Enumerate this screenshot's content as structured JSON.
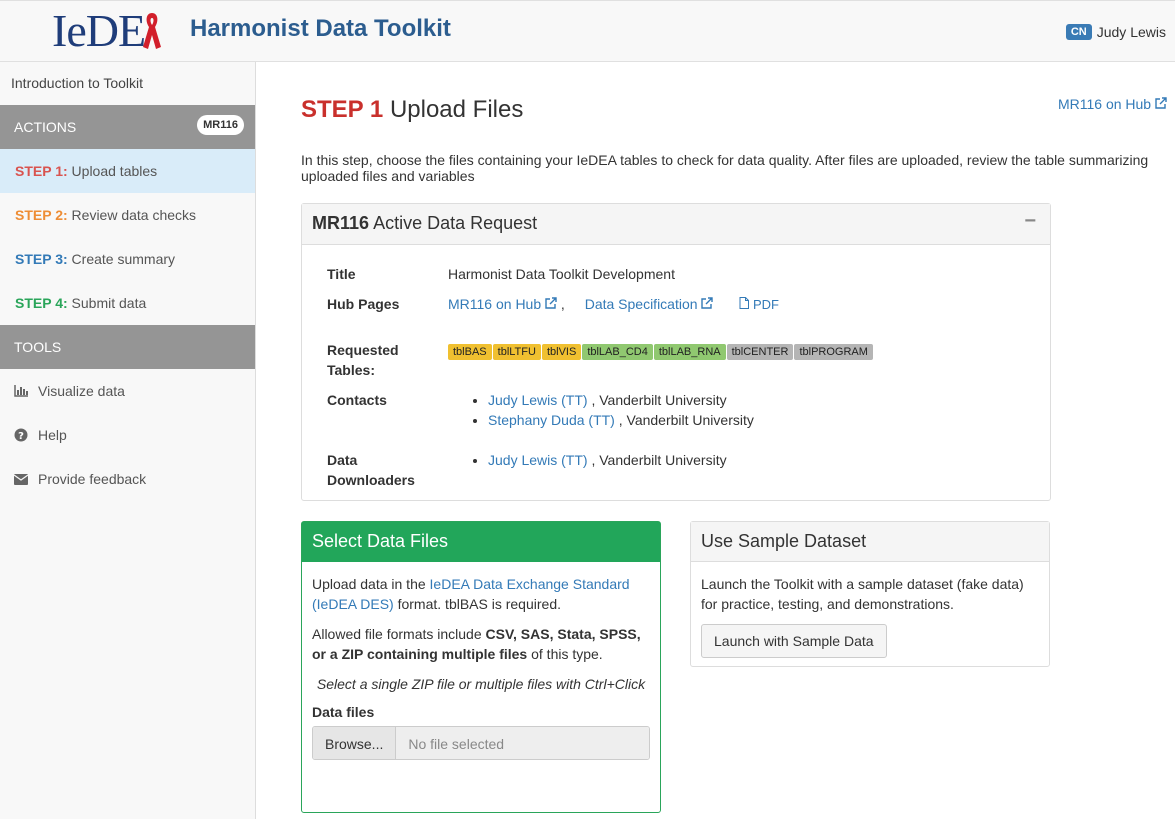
{
  "header": {
    "logo": "IeDE",
    "title": "Harmonist Data Toolkit",
    "user_initials": "CN",
    "user_name": "Judy Lewis"
  },
  "sidebar": {
    "intro": "Introduction to Toolkit",
    "actions_label": "ACTIONS",
    "actions_badge": "MR116",
    "steps": [
      {
        "step": "STEP 1:",
        "label": "Upload tables",
        "color": "#d9534f"
      },
      {
        "step": "STEP 2:",
        "label": "Review data checks",
        "color": "#ee8d35"
      },
      {
        "step": "STEP 3:",
        "label": "Create summary",
        "color": "#337ab7"
      },
      {
        "step": "STEP 4:",
        "label": "Submit data",
        "color": "#2aa55a"
      }
    ],
    "tools_label": "TOOLS",
    "tools": [
      {
        "label": "Visualize data",
        "icon": "bar-chart-icon"
      },
      {
        "label": "Help",
        "icon": "question-circle-icon"
      },
      {
        "label": "Provide feedback",
        "icon": "envelope-icon"
      }
    ]
  },
  "main": {
    "title_step": "STEP 1",
    "title_text": "Upload Files",
    "hub_link": "MR116 on Hub",
    "intro": "In this step, choose the files containing your IeDEA tables to check for data quality. After files are uploaded, review the table summarizing uploaded files and variables",
    "data_request": {
      "id": "MR116",
      "heading": "Active Data Request",
      "collapse": "−",
      "title_label": "Title",
      "title_value": "Harmonist Data Toolkit Development",
      "hub_label": "Hub Pages",
      "hub_link": "MR116 on Hub",
      "spec_link": "Data Specification",
      "pdf_link": "PDF",
      "tables_label": "Requested Tables:",
      "tables": [
        {
          "name": "tblBAS",
          "color": "#f0c030"
        },
        {
          "name": "tblLTFU",
          "color": "#f0c030"
        },
        {
          "name": "tblVIS",
          "color": "#f0c030"
        },
        {
          "name": "tblLAB_CD4",
          "color": "#90c870"
        },
        {
          "name": "tblLAB_RNA",
          "color": "#90c870"
        },
        {
          "name": "tblCENTER",
          "color": "#b5b5b5"
        },
        {
          "name": "tblPROGRAM",
          "color": "#b5b5b5"
        }
      ],
      "contacts_label": "Contacts",
      "contacts": [
        {
          "name": "Judy Lewis (TT)",
          "org": ", Vanderbilt University"
        },
        {
          "name": "Stephany Duda (TT)",
          "org": ", Vanderbilt University"
        }
      ],
      "downloaders_label": "Data Downloaders",
      "downloaders": [
        {
          "name": "Judy Lewis (TT)",
          "org": ", Vanderbilt University"
        }
      ]
    },
    "select_files": {
      "heading": "Select Data Files",
      "p1_pre": "Upload data in the ",
      "p1_link": "IeDEA Data Exchange Standard (IeDEA DES)",
      "p1_post": " format. tblBAS is required.",
      "p2_pre": "Allowed file formats include ",
      "p2_bold": "CSV, SAS, Stata, SPSS, or a ZIP containing multiple files",
      "p2_post": " of this type.",
      "hint": "Select a single ZIP file or multiple files with Ctrl+Click",
      "field_label": "Data files",
      "browse_label": "Browse...",
      "file_placeholder": "No file selected"
    },
    "sample": {
      "heading": "Use Sample Dataset",
      "text": "Launch the Toolkit with a sample dataset (fake data) for practice, testing, and demonstrations.",
      "button": "Launch with Sample Data"
    }
  }
}
